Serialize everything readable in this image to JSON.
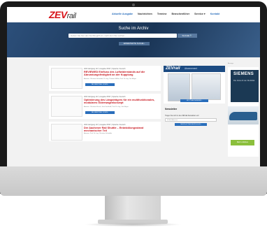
{
  "site": {
    "logo_main": "ZEV",
    "logo_sub": "rail"
  },
  "nav": [
    {
      "label": "Aktuelle Ausgabe",
      "active": true
    },
    {
      "label": "Nachrichten",
      "active": false
    },
    {
      "label": "Termine",
      "active": false
    },
    {
      "label": "Branchenfüher",
      "active": false
    },
    {
      "label": "Service ▾",
      "active": false
    },
    {
      "label": "Kontakt",
      "active": true
    }
  ],
  "search": {
    "title": "Suche im Archiv",
    "placeholder": "Geben Sie hier den Suchbegriff ein, nach dem Sie suchen",
    "button": "SUCHE 🔍",
    "advanced": "ERWEITERTE SUCHE ›"
  },
  "articles": [
    {
      "meta": "2023 Jahrgang 147 | Ausgabe 05/07 | Sprache: Deutsch",
      "title": "REVIEWED Einfluss des Luftwiderstands auf die Abrundungsfestigkeit an der Kupplung",
      "authors": "Autoren: Christian Schnabel, Dr.-Ing. Thomas Müller, Prof. Dr.-Ing. Jan Meyer",
      "button": "FACHBEITRAG LESEN ›"
    },
    {
      "meta": "2023 Jahrgang 147 | Ausgabe 05/07 | Sprache: Deutsch",
      "title": "Optimierung des Längsträgers für ein multifunktionales, modulares Güterwagenkonzept",
      "authors": "Autoren: Christian Kirsch, Jens Kirchhoff, Prof. Dr.-Ing. Jan Meyer",
      "button": "FACHBEITRAG LESEN ›"
    },
    {
      "meta": "2023 Jahrgang 147 | Ausgabe 05/07 | Sprache: Deutsch",
      "title": "Der Aachener Rail Shuttle – Entwicklungsstand mechanischer Teil",
      "authors": "Autoren: Prof. Dr.-Ing. Christian Schindler",
      "button": ""
    }
  ],
  "sidebar": {
    "abo_logo": "ZEVrail",
    "abo_label": "Abonnement",
    "abo_button": "JETZT ABONNIEREN ›",
    "newsletter_title": "Newsletter",
    "newsletter_text": "Tragen Sie sich in den ZEVrail-Newsletter ein!",
    "newsletter_placeholder": "E-Mail-Adresse",
    "newsletter_button": "NEWSLETTER BESTELLEN ›"
  },
  "banner": {
    "ad_label": "Anzeige",
    "brand": "SIEMENS",
    "text": "Die Zukunft der Mobilität",
    "button": "Mehr erfahren"
  },
  "colors": {
    "brand_red": "#d7141a",
    "link_blue": "#2a6ebb",
    "hero_blue": "#1a3556"
  }
}
